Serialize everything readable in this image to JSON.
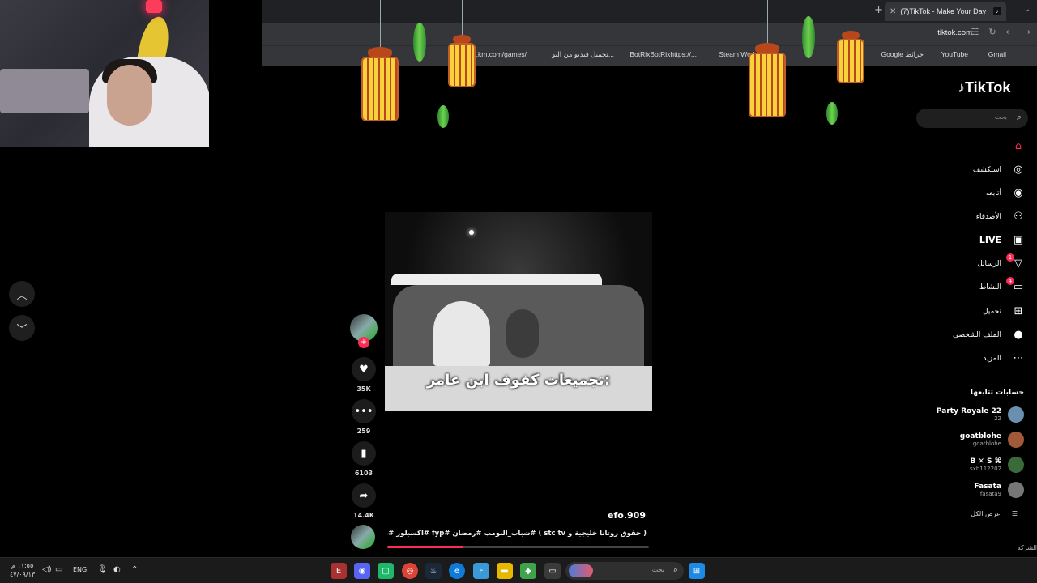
{
  "browser": {
    "tab_title": "(7)TikTok - Make Your Day",
    "url": "tiktok.com",
    "bookmarks": [
      "Gmail",
      "YouTube",
      "Google خرائط",
      "Steam Worksh...",
      "BotRixBotRixhttps://...",
      "تحميل فيديو من اليو...",
      "...km.com/games/"
    ]
  },
  "tiktok": {
    "logo": "TikTok",
    "search_placeholder": "بحث",
    "menu": [
      {
        "label": "",
        "icon": "home-icon"
      },
      {
        "label": "استكشف",
        "icon": "compass-icon"
      },
      {
        "label": "أتابعه",
        "icon": "following-icon"
      },
      {
        "label": "الأصدقاء",
        "icon": "friends-icon"
      },
      {
        "label": "LIVE",
        "icon": "live-icon"
      },
      {
        "label": "الرسائل",
        "icon": "messages-icon",
        "badge": "1"
      },
      {
        "label": "النشاط",
        "icon": "activity-icon",
        "badge": "4"
      },
      {
        "label": "تحميل",
        "icon": "upload-icon"
      },
      {
        "label": "الملف الشخصي",
        "icon": "profile-icon"
      },
      {
        "label": "المزيد",
        "icon": "more-icon"
      }
    ],
    "following_title": "حسابات تتابعها",
    "following": [
      {
        "name": "Party Royale 22",
        "handle": "22",
        "color": "#6b8fb0"
      },
      {
        "name": "goatblohe",
        "handle": "goatblohe",
        "color": "#a05a3a"
      },
      {
        "name": "B ✕ S ⌘",
        "handle": "sxb112202",
        "color": "#3a6a3a"
      },
      {
        "name": "Fasata",
        "handle": "fasata9",
        "color": "#777777"
      }
    ],
    "see_all": "عرض الكل",
    "company": "الشركة"
  },
  "video": {
    "caption": "تجميعات كفوف ابن عامر:",
    "author": "efo.909",
    "description": "( حقوق روتانا خليجية و stc tv ) #شباب_البومب #رمضان #fyp #اكسبلور #ضحك",
    "likes": "35K",
    "comments": "259",
    "saves": "6103",
    "shares": "14.4K",
    "progress": 0.29
  },
  "taskbar": {
    "time": "١١:٥٥ م",
    "date": "٤٧/٠٩/١٣",
    "lang": "ENG",
    "search_placeholder": "بحث"
  }
}
